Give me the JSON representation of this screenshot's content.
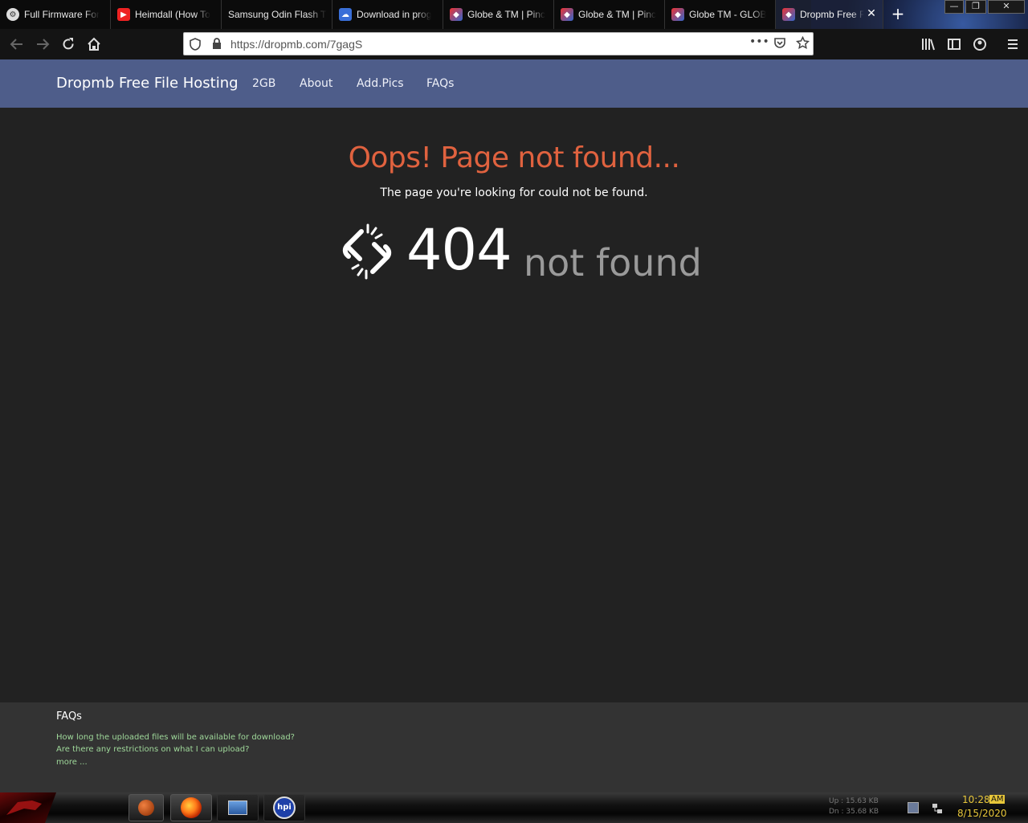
{
  "browser": {
    "tabs": [
      {
        "label": "Full Firmware For",
        "icon": "globe-icon"
      },
      {
        "label": "Heimdall (How To",
        "icon": "youtube-icon"
      },
      {
        "label": "Samsung Odin Flash T",
        "icon": "none"
      },
      {
        "label": "Download in prog",
        "icon": "cloud-icon"
      },
      {
        "label": "Globe & TM | Pinc",
        "icon": "cube-icon"
      },
      {
        "label": "Globe & TM | Pinc",
        "icon": "cube-icon"
      },
      {
        "label": "Globe TM - GLOB",
        "icon": "cube-icon"
      },
      {
        "label": "Dropmb Free F",
        "icon": "cube-icon"
      }
    ],
    "url": "https://dropmb.com/7gagS"
  },
  "site": {
    "brand": "Dropmb Free File Hosting",
    "nav": [
      "2GB",
      "About",
      "Add.Pics",
      "FAQs"
    ]
  },
  "error": {
    "title": "Oops! Page not found...",
    "subtitle": "The page you're looking for could not be found.",
    "code": "404",
    "code_text": "not found"
  },
  "footer": {
    "title": "FAQs",
    "links": [
      "How long the uploaded files will be available for download?",
      "Are there any restrictions on what I can upload?",
      "more ..."
    ]
  },
  "taskbar": {
    "net_up": "Up : 15.63 KB",
    "net_down": "Dn : 35.68 KB",
    "time": "10:28",
    "ampm": "AM",
    "date": "8/15/2020"
  },
  "colors": {
    "site_header": "#4e5d8a",
    "error_title": "#e0623f",
    "footer_link": "#9fd89a",
    "clock": "#e8c73a"
  }
}
